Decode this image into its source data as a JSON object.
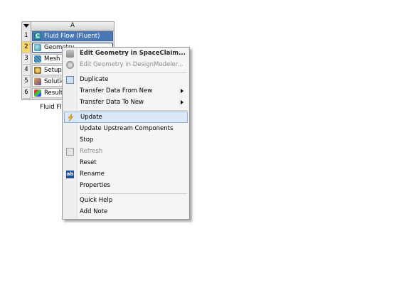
{
  "system": {
    "column_header": "A",
    "rows": [
      {
        "num": "1",
        "label": "Fluid Flow (Fluent)",
        "icon": "fluent-icon"
      },
      {
        "num": "2",
        "label": "Geometry",
        "icon": "geometry-icon"
      },
      {
        "num": "3",
        "label": "Mesh",
        "icon": "mesh-icon"
      },
      {
        "num": "4",
        "label": "Setup",
        "icon": "setup-icon"
      },
      {
        "num": "5",
        "label": "Solution",
        "icon": "solution-icon"
      },
      {
        "num": "6",
        "label": "Results",
        "icon": "results-icon"
      }
    ],
    "name": "Fluid Flow (Fluent)"
  },
  "menu": {
    "items": [
      {
        "label": "Edit Geometry in SpaceClaim...",
        "icon": "spaceclaim-icon"
      },
      {
        "label": "Edit Geometry in DesignModeler...",
        "icon": "designmodeler-icon"
      },
      {
        "label": "Duplicate",
        "icon": "duplicate-icon"
      },
      {
        "label": "Transfer Data From New"
      },
      {
        "label": "Transfer Data To New"
      },
      {
        "label": "Update",
        "icon": "update-icon"
      },
      {
        "label": "Update Upstream Components"
      },
      {
        "label": "Stop"
      },
      {
        "label": "Refresh",
        "icon": "refresh-icon"
      },
      {
        "label": "Reset"
      },
      {
        "label": "Rename",
        "icon": "rename-icon",
        "icon_text": "ab"
      },
      {
        "label": "Properties"
      },
      {
        "label": "Quick Help"
      },
      {
        "label": "Add Note"
      }
    ]
  },
  "colors": {
    "title_row": "#4a78b5",
    "selected_row_number": "#f6d56a",
    "menu_highlight": "#dbe8f8"
  }
}
